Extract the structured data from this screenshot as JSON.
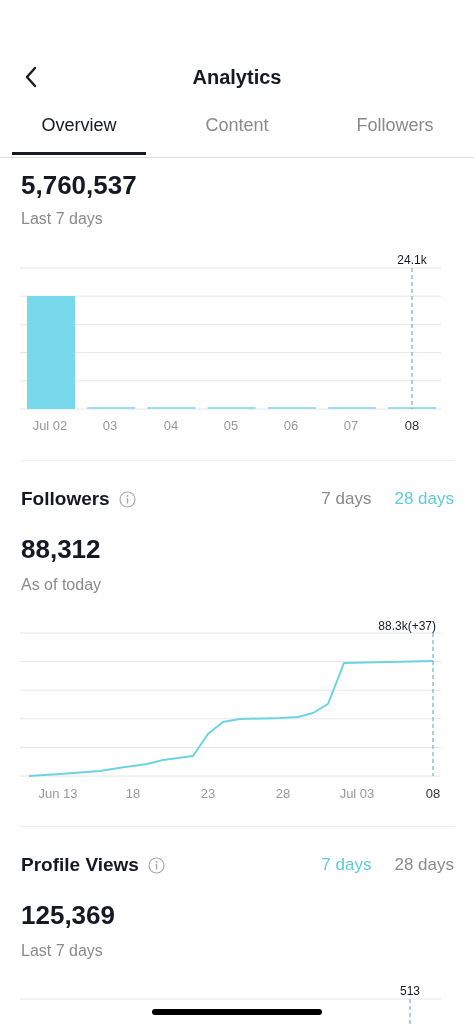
{
  "header": {
    "title": "Analytics"
  },
  "tabs": [
    {
      "label": "Overview",
      "selected": true
    },
    {
      "label": "Content",
      "selected": false
    },
    {
      "label": "Followers",
      "selected": false
    }
  ],
  "sections": [
    {
      "kind": "bars",
      "value": "5,760,537",
      "caption": "Last 7 days",
      "chart": {
        "marker": "24.1k",
        "x_labels": [
          "Jul 02",
          "03",
          "04",
          "05",
          "06",
          "07",
          "08"
        ]
      }
    },
    {
      "kind": "line",
      "title": "Followers",
      "ranges": [
        {
          "label": "7 days",
          "selected": false
        },
        {
          "label": "28 days",
          "selected": true
        }
      ],
      "value": "88,312",
      "caption": "As of today",
      "chart": {
        "marker": "88.3k(+37)",
        "x_labels": [
          "Jun 13",
          "18",
          "23",
          "28",
          "Jul 03",
          "08"
        ]
      }
    },
    {
      "kind": "partial",
      "title": "Profile Views",
      "ranges": [
        {
          "label": "7 days",
          "selected": true
        },
        {
          "label": "28 days",
          "selected": false
        }
      ],
      "value": "125,369",
      "caption": "Last 7 days",
      "chart": {
        "marker": "513"
      }
    }
  ]
}
